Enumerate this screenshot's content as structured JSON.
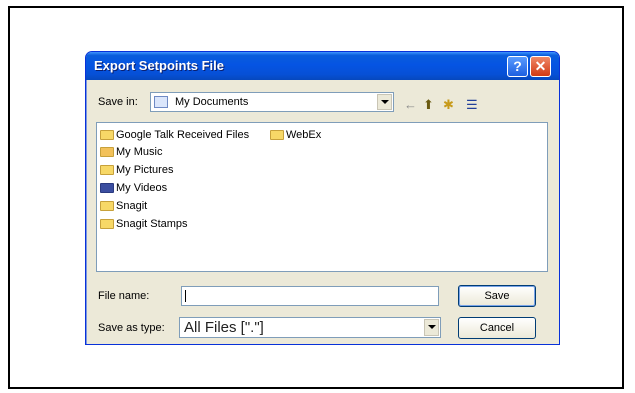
{
  "dialog": {
    "title": "Export Setpoints File",
    "help_label": "?",
    "close_label": "✕"
  },
  "save_in": {
    "label": "Save in:",
    "value": "My Documents"
  },
  "toolbar": {
    "back_icon": "←",
    "up_icon": "⬆",
    "new_folder_icon": "✱",
    "views_icon": "☰"
  },
  "files": [
    {
      "name": "Google Talk Received Files",
      "icon": "folder-icon"
    },
    {
      "name": "WebEx",
      "icon": "folder-icon"
    },
    {
      "name": "My Music",
      "icon": "music-folder-icon"
    },
    {
      "name": "My Pictures",
      "icon": "pictures-folder-icon"
    },
    {
      "name": "My Videos",
      "icon": "videos-folder-icon"
    },
    {
      "name": "Snagit",
      "icon": "folder-icon"
    },
    {
      "name": "Snagit Stamps",
      "icon": "folder-icon"
    }
  ],
  "file_name": {
    "label": "File name:",
    "value": ""
  },
  "save_as_type": {
    "label": "Save as type:",
    "value": "All Files [\".\"]"
  },
  "buttons": {
    "save": "Save",
    "cancel": "Cancel"
  }
}
